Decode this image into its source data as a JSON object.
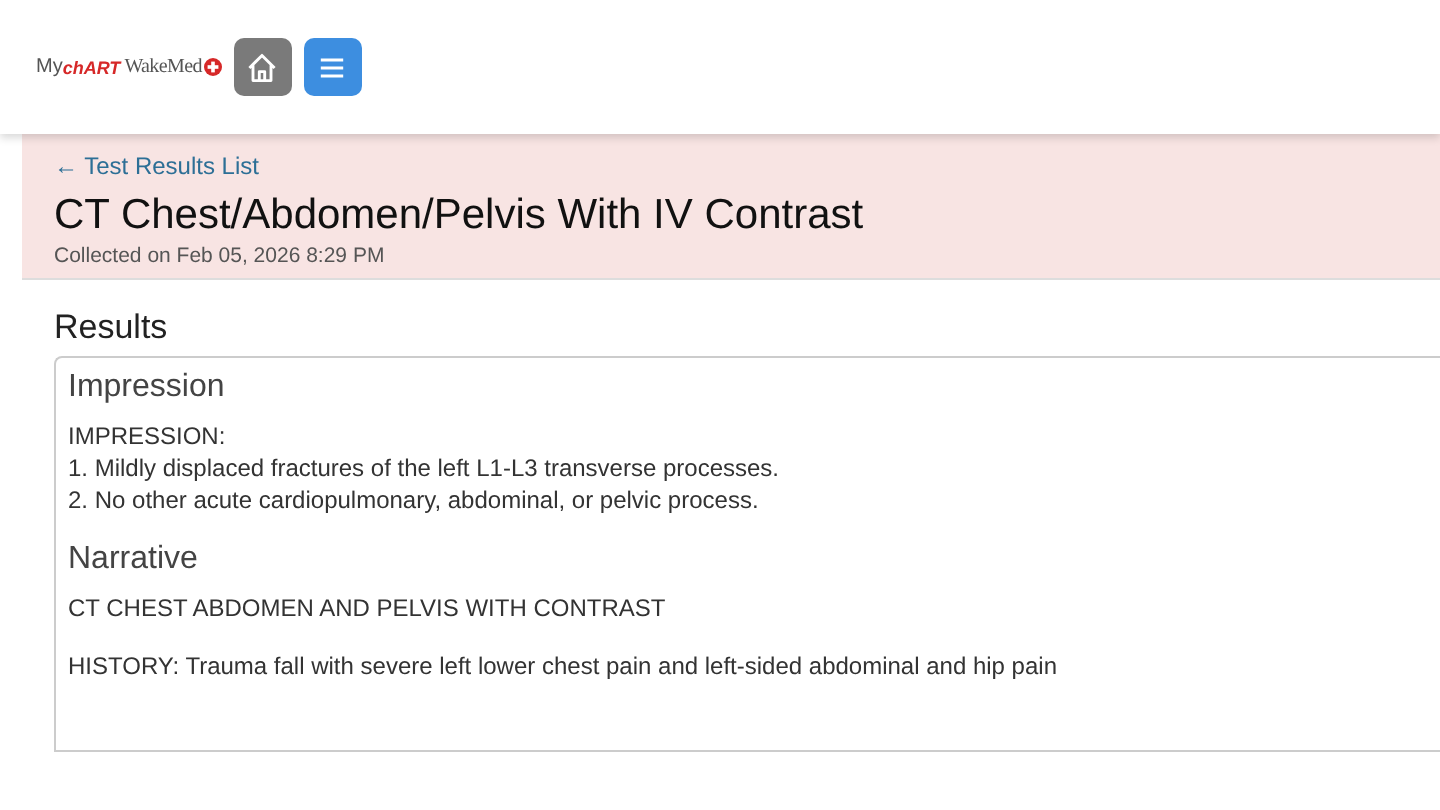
{
  "header": {
    "logo": {
      "prefix": "My",
      "brand": "chART",
      "org": "WakeMed"
    }
  },
  "result": {
    "back_link": "← Test Results List",
    "title": "CT Chest/Abdomen/Pelvis With IV Contrast",
    "collected": "Collected on Feb 05, 2026 8:29 PM"
  },
  "results": {
    "heading": "Results",
    "sections": [
      {
        "heading": "Impression",
        "paragraphs": [
          [
            "IMPRESSION:",
            "1. Mildly displaced fractures of the left L1-L3 transverse processes.",
            "2. No other acute cardiopulmonary, abdominal, or pelvic process."
          ]
        ]
      },
      {
        "heading": "Narrative",
        "paragraphs": [
          [
            "CT CHEST ABDOMEN AND PELVIS WITH CONTRAST"
          ],
          [
            "HISTORY: Trauma fall with severe left lower chest pain and left-sided abdominal and hip pain"
          ]
        ]
      }
    ]
  }
}
